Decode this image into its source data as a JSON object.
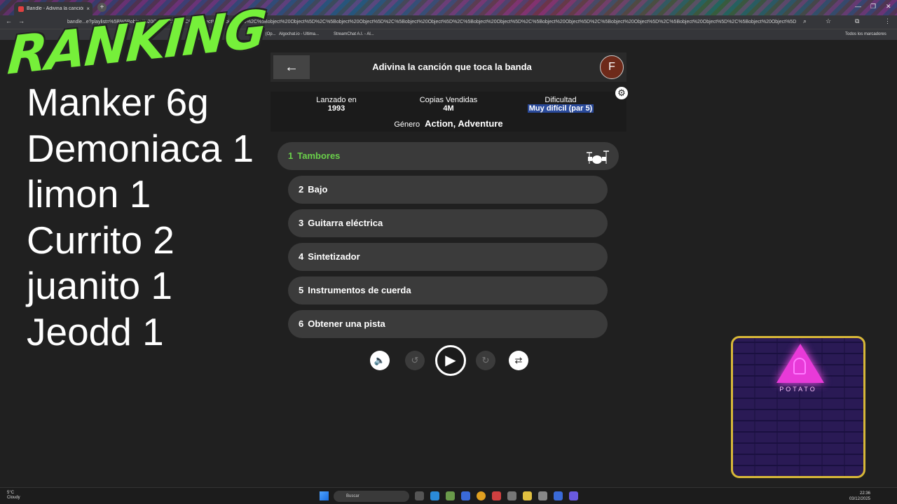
{
  "browser": {
    "tab_title": "Bandle - Adivina la canción, un",
    "tab_close": "×",
    "new_tab": "+",
    "url": "bandle...e?playlist=%5B%5Bobject%20Object%5D%2C%5Bobject%20Object%5D%2C%5Bobject%20Object%5D%2C%5Bobject%20Object%5D%2C%5Bobject%20Object%5D%2C%5Bobject%20Object%5D%2C%5Bobject%20Object%5D%2C%5Bobject%20Object%5D%2C%5Bobject%20Object%5D%2C%5Bobject%20Object%5D%2C%5Bobject%20Object%5D%2C%5Bobject%20Object%5D",
    "bookmarks": [
      "ChatGPT (Op...",
      "Algochat.io - Ultima...",
      "StreamChat A.I. - Al..."
    ],
    "bookmarks_folder": "Todos los marcadores"
  },
  "ranking": {
    "title": "RANKING",
    "items": [
      "Manker 6g",
      "Demoniaca 1",
      "limon 1",
      "Currito 2",
      "juanito 1",
      "Jeodd 1"
    ]
  },
  "header": {
    "back_icon": "←",
    "title": "Adivina la canción que toca la banda",
    "avatar_letter": "F",
    "settings_icon": "⚙"
  },
  "info": {
    "released_label": "Lanzado en",
    "released_value": "1993",
    "copies_label": "Copias Vendidas",
    "copies_value": "4M",
    "difficulty_label": "Dificultad",
    "difficulty_value": "Muy difícil (par 5)",
    "genre_label": "Género",
    "genre_value": "Action, Adventure"
  },
  "clues": [
    {
      "num": "1",
      "label": "Tambores"
    },
    {
      "num": "2",
      "label": "Bajo"
    },
    {
      "num": "3",
      "label": "Guitarra eléctrica"
    },
    {
      "num": "4",
      "label": "Sintetizador"
    },
    {
      "num": "5",
      "label": "Instrumentos de cuerda"
    },
    {
      "num": "6",
      "label": "Obtener una pista"
    }
  ],
  "controls": {
    "volume_icon": "🔈",
    "rewind_icon": "↺",
    "play_icon": "▶",
    "forward_icon": "↻",
    "shuffle_icon": "⇄"
  },
  "webcam": {
    "label": "POTATO"
  },
  "taskbar": {
    "temp": "5°C",
    "weather": "Cloudy",
    "search": "Buscar",
    "time": "22:36",
    "date": "03/12/2025"
  }
}
